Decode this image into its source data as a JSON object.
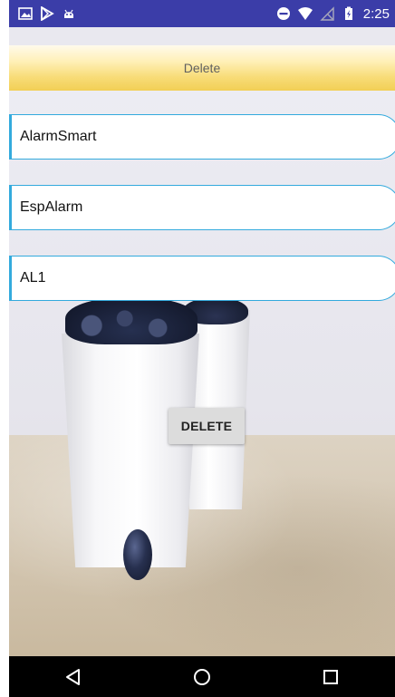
{
  "status_bar": {
    "time": "2:25",
    "left_icons": [
      "image-icon",
      "play-store-icon",
      "android-icon"
    ],
    "right_icons": [
      "do-not-disturb-icon",
      "wifi-icon",
      "no-signal-icon",
      "battery-charging-icon"
    ]
  },
  "header": {
    "title": "Delete"
  },
  "entries": [
    {
      "label": "AlarmSmart"
    },
    {
      "label": "EspAlarm"
    },
    {
      "label": "AL1"
    }
  ],
  "delete_button": {
    "label": "DELETE"
  },
  "nav_bar": {
    "icons": [
      "back-icon",
      "home-icon",
      "recents-icon"
    ]
  },
  "colors": {
    "status_bar": "#3b3da8",
    "entry_border": "#33aadd",
    "title_gradient_end": "#f2cf55",
    "nav_bar": "#000000"
  }
}
